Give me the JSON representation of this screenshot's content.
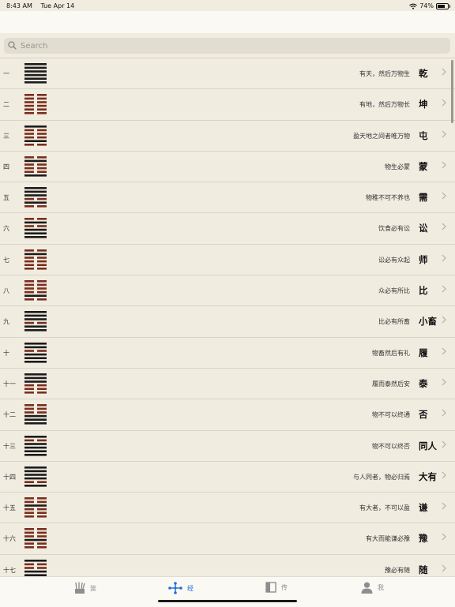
{
  "status_bar": {
    "time": "8:43 AM",
    "date": "Tue Apr 14",
    "battery": "74%",
    "battery_level": 0.74
  },
  "search": {
    "placeholder": "Search",
    "value": ""
  },
  "colors": {
    "yang": "#1b1b1b",
    "yin": "#7a2e1e",
    "active_tab": "#1e6fe0",
    "inactive_tab": "#8e8e8e"
  },
  "hexagrams": [
    {
      "num": "一",
      "desc": "有天，然后万物生",
      "name": "乾",
      "lines": [
        1,
        1,
        1,
        1,
        1,
        1
      ]
    },
    {
      "num": "二",
      "desc": "有地，然后万物长",
      "name": "坤",
      "lines": [
        0,
        0,
        0,
        0,
        0,
        0
      ]
    },
    {
      "num": "三",
      "desc": "盈天地之间者唯万物",
      "name": "屯",
      "lines": [
        0,
        1,
        0,
        0,
        0,
        1
      ]
    },
    {
      "num": "四",
      "desc": "物生必蒙",
      "name": "蒙",
      "lines": [
        1,
        0,
        0,
        0,
        1,
        0
      ]
    },
    {
      "num": "五",
      "desc": "物稚不可不养也",
      "name": "需",
      "lines": [
        0,
        1,
        0,
        1,
        1,
        1
      ]
    },
    {
      "num": "六",
      "desc": "饮食必有讼",
      "name": "讼",
      "lines": [
        1,
        1,
        1,
        0,
        1,
        0
      ]
    },
    {
      "num": "七",
      "desc": "讼必有众起",
      "name": "师",
      "lines": [
        0,
        0,
        0,
        0,
        1,
        0
      ]
    },
    {
      "num": "八",
      "desc": "众必有所比",
      "name": "比",
      "lines": [
        0,
        1,
        0,
        0,
        0,
        0
      ]
    },
    {
      "num": "九",
      "desc": "比必有所畜",
      "name": "小畜",
      "lines": [
        1,
        1,
        0,
        1,
        1,
        1
      ]
    },
    {
      "num": "十",
      "desc": "物畜然后有礼",
      "name": "履",
      "lines": [
        1,
        1,
        1,
        0,
        1,
        1
      ]
    },
    {
      "num": "十一",
      "desc": "履而泰然后安",
      "name": "泰",
      "lines": [
        0,
        0,
        0,
        1,
        1,
        1
      ]
    },
    {
      "num": "十二",
      "desc": "物不可以终通",
      "name": "否",
      "lines": [
        1,
        1,
        1,
        0,
        0,
        0
      ]
    },
    {
      "num": "十三",
      "desc": "物不可以终否",
      "name": "同人",
      "lines": [
        1,
        1,
        1,
        1,
        0,
        1
      ]
    },
    {
      "num": "十四",
      "desc": "与人同者，物必归焉",
      "name": "大有",
      "lines": [
        1,
        0,
        1,
        1,
        1,
        1
      ]
    },
    {
      "num": "十五",
      "desc": "有大者，不可以盈",
      "name": "谦",
      "lines": [
        0,
        0,
        0,
        1,
        0,
        0
      ]
    },
    {
      "num": "十六",
      "desc": "有大而能谦必豫",
      "name": "豫",
      "lines": [
        0,
        0,
        1,
        0,
        0,
        0
      ]
    },
    {
      "num": "十七",
      "desc": "豫必有随",
      "name": "随",
      "lines": [
        0,
        1,
        1,
        0,
        0,
        1
      ]
    }
  ],
  "tabs": [
    {
      "label": "筮",
      "icon": "divination-sticks-icon",
      "active": false
    },
    {
      "label": "经",
      "icon": "network-nodes-icon",
      "active": true
    },
    {
      "label": "传",
      "icon": "book-icon",
      "active": false
    },
    {
      "label": "我",
      "icon": "person-icon",
      "active": false
    }
  ]
}
